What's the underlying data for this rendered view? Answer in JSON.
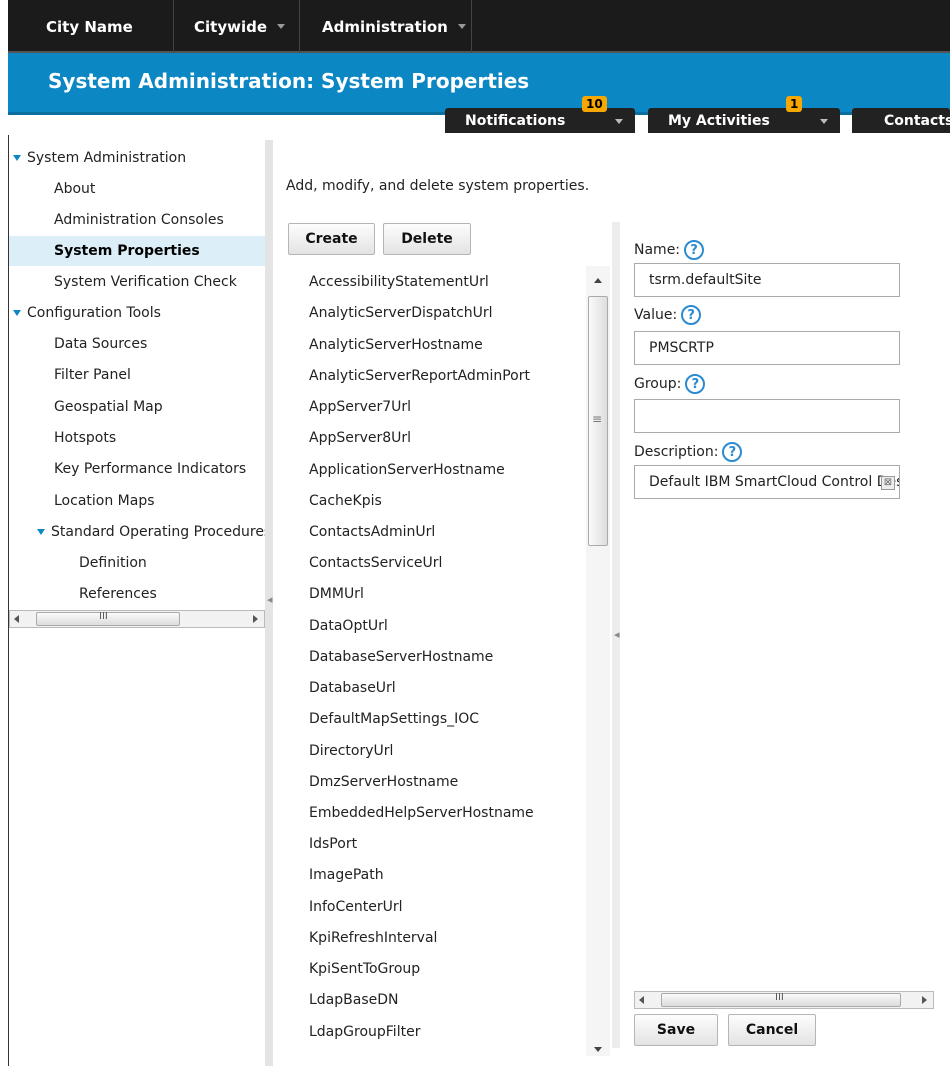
{
  "topnav": {
    "city_name": "City Name",
    "citywide": "Citywide",
    "administration": "Administration"
  },
  "header": {
    "title": "System Administration: System Properties"
  },
  "tabs": {
    "notifications": {
      "label": "Notifications",
      "count": "10"
    },
    "my_activities": {
      "label": "My Activities",
      "count": "1"
    },
    "contacts": {
      "label": "Contacts"
    }
  },
  "tree": {
    "items": [
      {
        "label": "System Administration"
      },
      {
        "label": "About"
      },
      {
        "label": "Administration Consoles"
      },
      {
        "label": "System Properties"
      },
      {
        "label": "System Verification Check"
      },
      {
        "label": "Configuration Tools"
      },
      {
        "label": "Data Sources"
      },
      {
        "label": "Filter Panel"
      },
      {
        "label": "Geospatial Map"
      },
      {
        "label": "Hotspots"
      },
      {
        "label": "Key Performance Indicators"
      },
      {
        "label": "Location Maps"
      },
      {
        "label": "Standard Operating Procedures"
      },
      {
        "label": "Definition"
      },
      {
        "label": "References"
      }
    ],
    "scroll_grip": "III"
  },
  "main": {
    "intro": "Add, modify, and delete system properties.",
    "create_label": "Create",
    "delete_label": "Delete",
    "properties": [
      "AccessibilityStatementUrl",
      "AnalyticServerDispatchUrl",
      "AnalyticServerHostname",
      "AnalyticServerReportAdminPort",
      "AppServer7Url",
      "AppServer8Url",
      "ApplicationServerHostname",
      "CacheKpis",
      "ContactsAdminUrl",
      "ContactsServiceUrl",
      "DMMUrl",
      "DataOptUrl",
      "DatabaseServerHostname",
      "DatabaseUrl",
      "DefaultMapSettings_IOC",
      "DirectoryUrl",
      "DmzServerHostname",
      "EmbeddedHelpServerHostname",
      "IdsPort",
      "ImagePath",
      "InfoCenterUrl",
      "KpiRefreshInterval",
      "KpiSentToGroup",
      "LdapBaseDN",
      "LdapGroupFilter"
    ]
  },
  "form": {
    "name_label": "Name:",
    "name_value": "tsrm.defaultSite",
    "value_label": "Value:",
    "value_value": "PMSCRTP",
    "group_label": "Group:",
    "group_value": "",
    "description_label": "Description:",
    "description_value": "Default IBM SmartCloud Control Desk site",
    "help_glyph": "?",
    "save_label": "Save",
    "cancel_label": "Cancel",
    "scroll_grip": "III"
  },
  "colors": {
    "header_blue": "#0b87c4",
    "nav_dark": "#1b1b1b",
    "badge_orange": "#f7a800",
    "selected_row": "#dceef8"
  }
}
